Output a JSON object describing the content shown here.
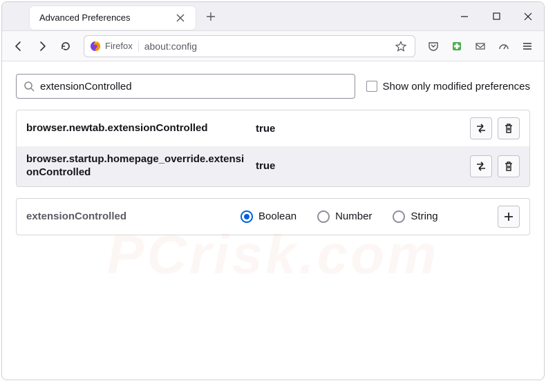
{
  "window": {
    "tab_title": "Advanced Preferences"
  },
  "toolbar": {
    "identity_label": "Firefox",
    "url": "about:config"
  },
  "search": {
    "value": "extensionControlled",
    "show_modified_label": "Show only modified preferences"
  },
  "prefs": [
    {
      "name": "browser.newtab.extensionControlled",
      "value": "true"
    },
    {
      "name": "browser.startup.homepage_override.extensionControlled",
      "value": "true"
    }
  ],
  "new_pref": {
    "name": "extensionControlled",
    "types": [
      "Boolean",
      "Number",
      "String"
    ],
    "selected": "Boolean"
  },
  "watermark": "PCrisk.com"
}
